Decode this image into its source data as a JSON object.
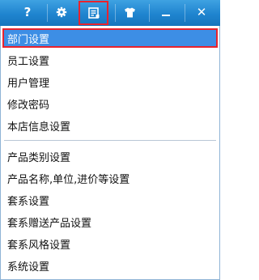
{
  "toolbar": {
    "help_glyph": "?",
    "icons": [
      "help-icon",
      "gear-icon",
      "settings-list-icon",
      "shirt-icon",
      "minimize-icon",
      "close-icon"
    ],
    "active_icon": "settings-list-icon",
    "close_glyph": "✕"
  },
  "menu": {
    "group1": [
      "部门设置",
      "员工设置",
      "用户管理",
      "修改密码",
      "本店信息设置"
    ],
    "group2": [
      "产品类别设置",
      "产品名称,单位,进价等设置",
      "套系设置",
      "套系赠送产品设置",
      "套系风格设置",
      "系统设置"
    ],
    "selected": "部门设置"
  },
  "colors": {
    "titlebar": "#1f84cf",
    "selection": "#3d8ee5",
    "highlight_border": "#e8232d"
  }
}
